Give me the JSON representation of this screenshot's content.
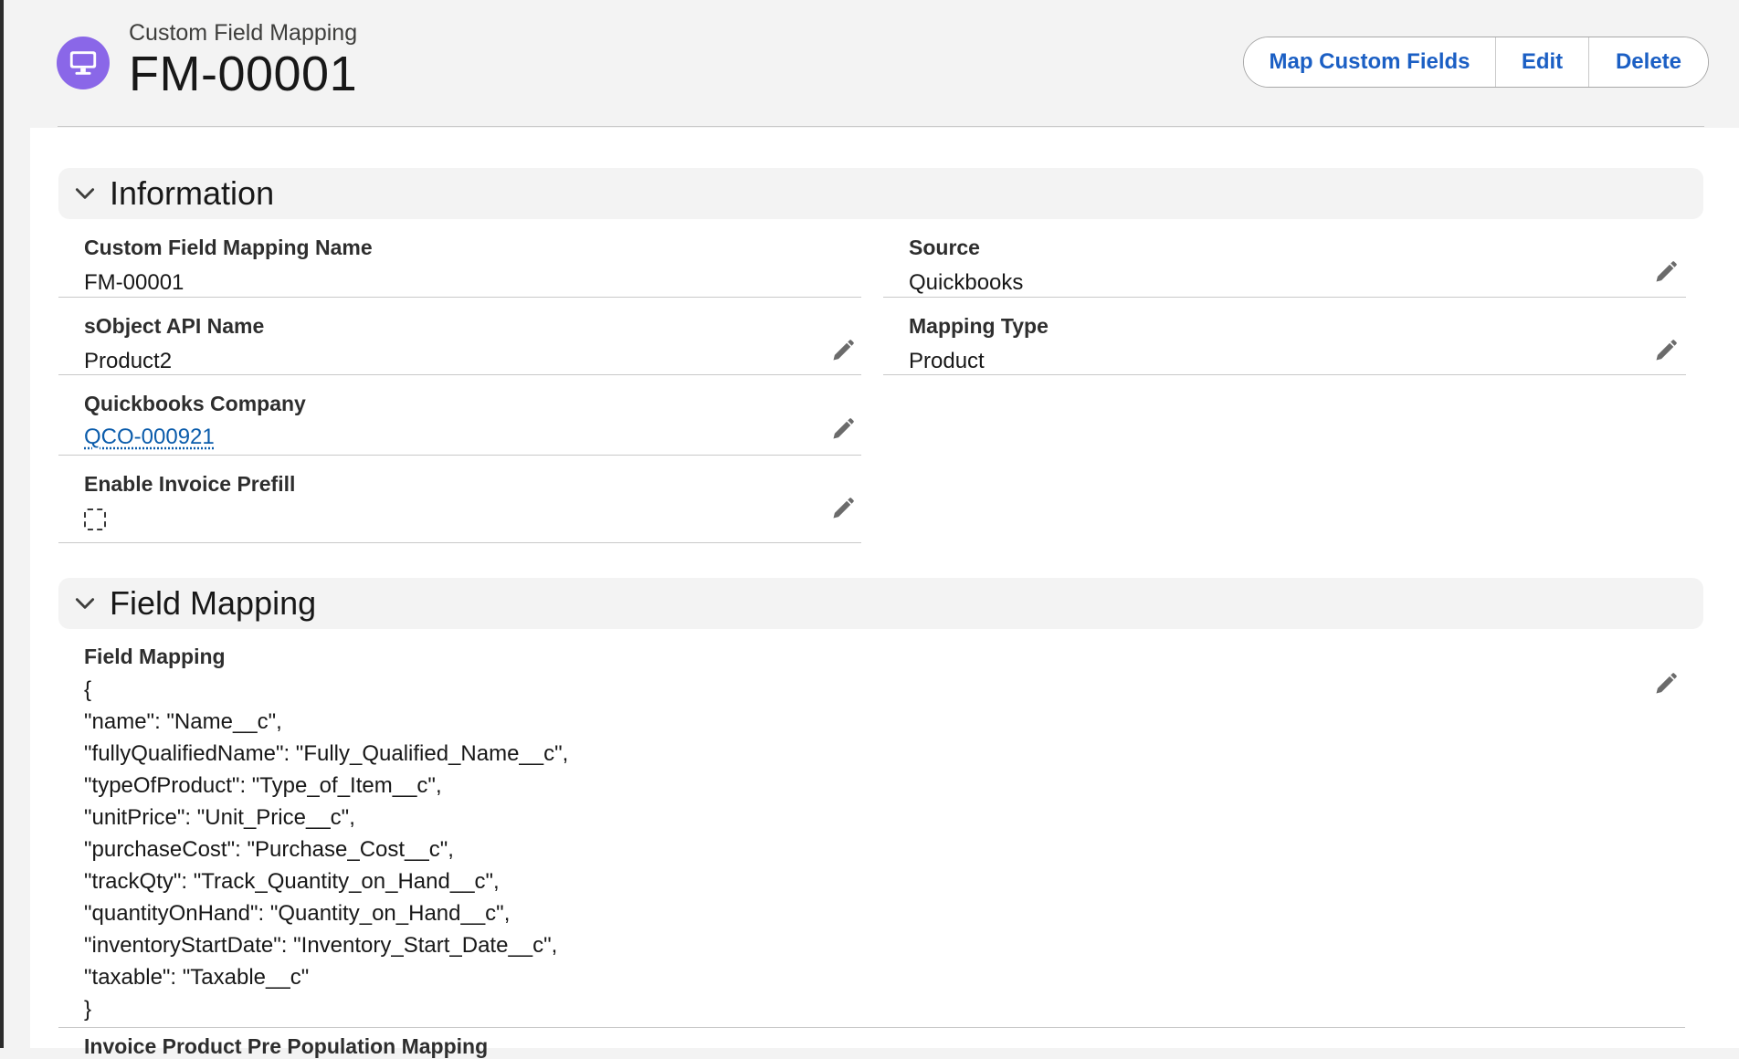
{
  "header": {
    "record_type": "Custom Field Mapping",
    "record_name": "FM-00001",
    "icon": "desktop-icon",
    "actions": {
      "map_custom_fields": "Map Custom Fields",
      "edit": "Edit",
      "delete": "Delete"
    }
  },
  "sections": {
    "information": {
      "title": "Information",
      "fields": {
        "name": {
          "label": "Custom Field Mapping Name",
          "value": "FM-00001"
        },
        "source": {
          "label": "Source",
          "value": "Quickbooks"
        },
        "sobject": {
          "label": "sObject API Name",
          "value": "Product2"
        },
        "mapping_type": {
          "label": "Mapping Type",
          "value": "Product"
        },
        "qb_company": {
          "label": "Quickbooks Company",
          "value": "QCO-000921"
        },
        "invoice_prefill": {
          "label": "Enable Invoice Prefill",
          "checked": false
        }
      }
    },
    "field_mapping": {
      "title": "Field Mapping",
      "label": "Field Mapping",
      "lines": [
        "{",
        "\"name\": \"Name__c\",",
        "\"fullyQualifiedName\": \"Fully_Qualified_Name__c\",",
        "\"typeOfProduct\": \"Type_of_Item__c\",",
        "\"unitPrice\": \"Unit_Price__c\",",
        "\"purchaseCost\": \"Purchase_Cost__c\",",
        "\"trackQty\": \"Track_Quantity_on_Hand__c\",",
        "\"quantityOnHand\": \"Quantity_on_Hand__c\",",
        "\"inventoryStartDate\": \"Inventory_Start_Date__c\",",
        "\"taxable\": \"Taxable__c\"",
        "}"
      ],
      "next_label": "Invoice Product Pre Population Mapping"
    }
  },
  "colors": {
    "accent_link": "#0b5cab",
    "icon_bg": "#8a67e8",
    "page_bg": "#f3f3f3"
  }
}
